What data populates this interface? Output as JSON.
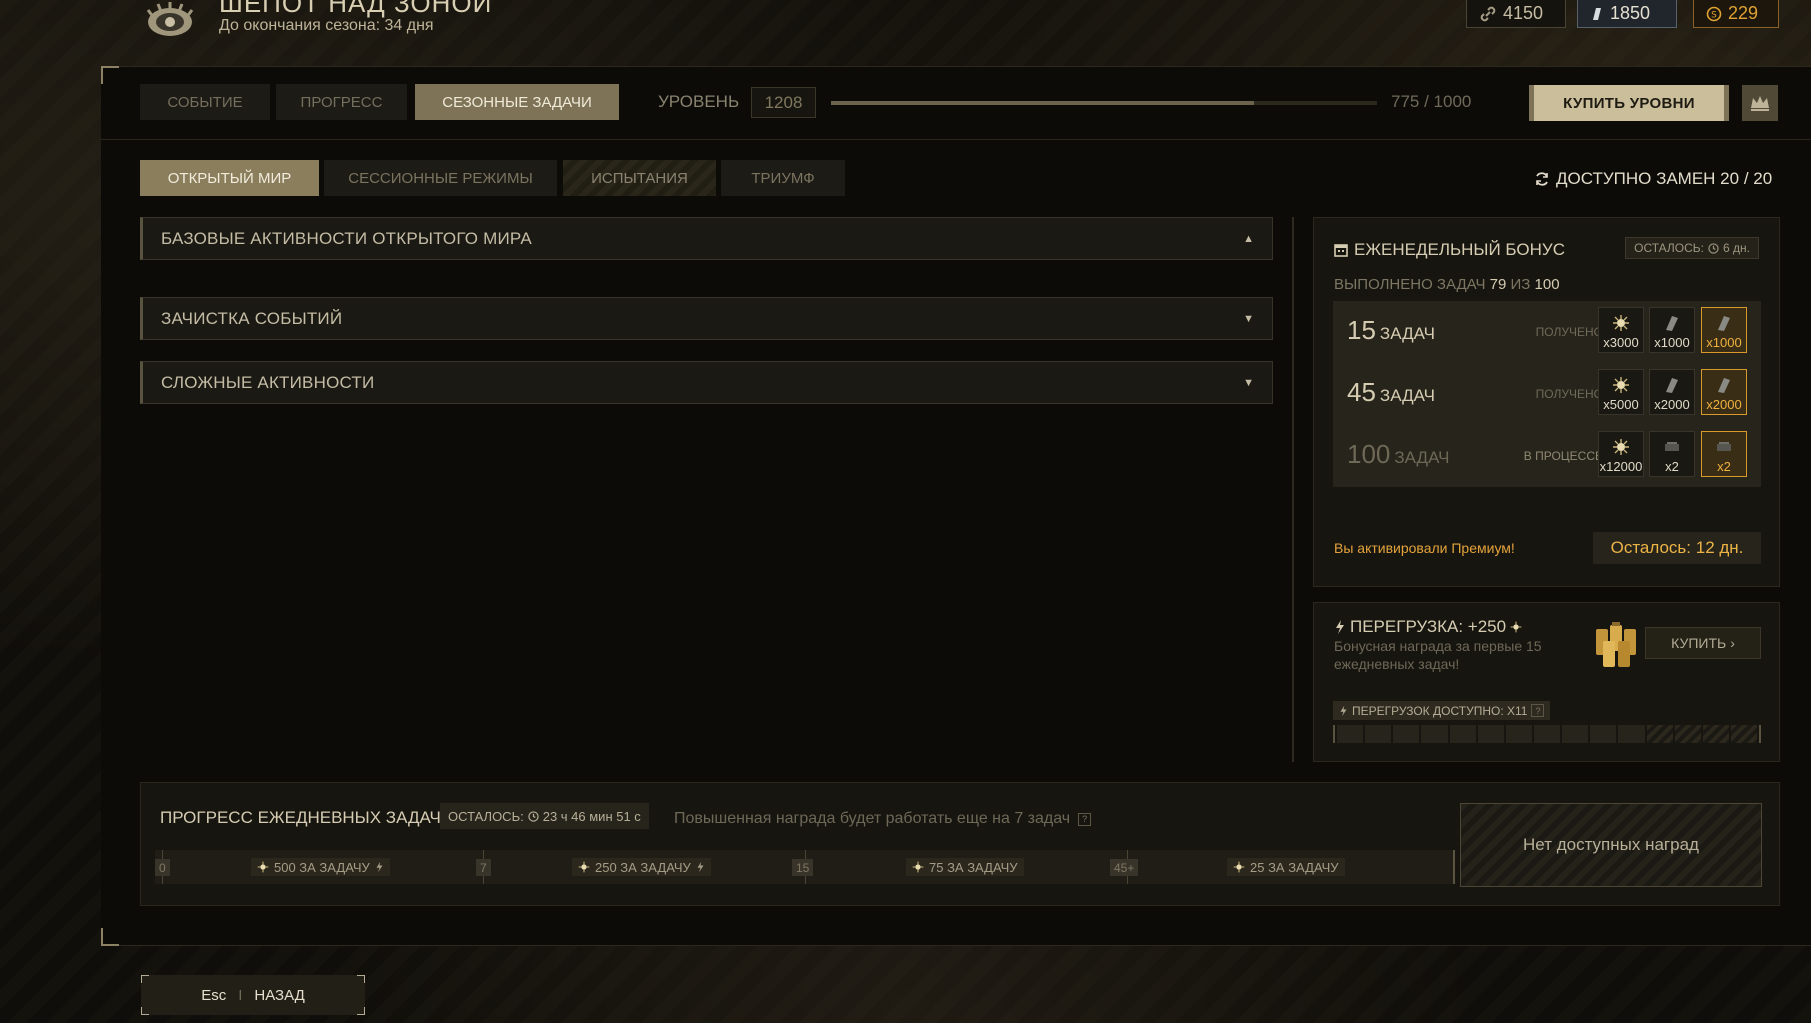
{
  "header": {
    "title": "ШЕПОТ НАД ЗОНОЙ",
    "season_left": "До окончания сезона: 34 дня"
  },
  "currencies": [
    {
      "icon": "link-icon",
      "value": "4150"
    },
    {
      "icon": "crystal-icon",
      "value": "1850"
    },
    {
      "icon": "coin-icon",
      "value": "229",
      "color": "#e0a332"
    }
  ],
  "top_tabs": [
    {
      "label": "СОБЫТИЕ",
      "active": false
    },
    {
      "label": "ПРОГРЕСС",
      "active": false
    },
    {
      "label": "СЕЗОННЫЕ ЗАДАЧИ",
      "active": true
    }
  ],
  "level": {
    "label": "УРОВЕНЬ",
    "value": "1208",
    "progress_text": "775 / 1000",
    "progress_fraction": 0.775
  },
  "buy_levels_label": "КУПИТЬ УРОВНИ",
  "sub_tabs": [
    {
      "label": "ОТКРЫТЫЙ МИР",
      "active": true
    },
    {
      "label": "СЕССИОННЫЕ РЕЖИМЫ",
      "active": false
    },
    {
      "label": "ИСПЫТАНИЯ",
      "active": false
    },
    {
      "label": "ТРИУМФ",
      "active": false
    }
  ],
  "swaps_label": "ДОСТУПНО ЗАМЕН 20 / 20",
  "accordions": [
    {
      "label": "БАЗОВЫЕ АКТИВНОСТИ ОТКРЫТОГО МИРА",
      "arrow": "▲"
    },
    {
      "label": "ЗАЧИСТКА СОБЫТИЙ",
      "arrow": "▼"
    },
    {
      "label": "СЛОЖНЫЕ АКТИВНОСТИ",
      "arrow": "▼"
    }
  ],
  "weekly": {
    "title": "ЕЖЕНЕДЕЛЬНЫЙ БОНУС",
    "left_label": "ОСТАЛОСЬ:",
    "left_value": "6 дн.",
    "done_prefix": "ВЫПОЛНЕНО ЗАДАЧ",
    "done_count": "79",
    "done_of": "ИЗ",
    "done_total": "100",
    "tiers": [
      {
        "num": "15",
        "unit": "ЗАДАЧ",
        "status": "ПОЛУЧЕНО",
        "rewards": [
          "x3000",
          "x1000",
          "x1000"
        ]
      },
      {
        "num": "45",
        "unit": "ЗАДАЧ",
        "status": "ПОЛУЧЕНО",
        "rewards": [
          "x5000",
          "x2000",
          "x2000"
        ]
      },
      {
        "num": "100",
        "unit": "ЗАДАЧ",
        "status": "В ПРОЦЕССЕ",
        "rewards": [
          "x12000",
          "x2",
          "x2"
        ]
      }
    ],
    "premium_text": "Вы активировали Премиум!",
    "premium_left": "Осталось: 12 дн."
  },
  "overload": {
    "title": "ПЕРЕГРУЗКА: +250",
    "desc": "Бонусная награда за первые 15 ежедневных задач!",
    "buy_label": "КУПИТЬ",
    "available": "ПЕРЕГРУЗОК ДОСТУПНО: x11",
    "help": "?",
    "segments_filled": 11,
    "segments_total": 15
  },
  "daily": {
    "title": "ПРОГРЕСС ЕЖЕДНЕВНЫХ ЗАДАЧ",
    "left_label": "ОСТАЛОСЬ:",
    "left_value": "23 ч 46 мин 51 с",
    "note": "Повышенная награда будет работать еще на 7 задач",
    "help": "?",
    "marks": [
      "0",
      "7",
      "15",
      "45+"
    ],
    "rewards": [
      "500 ЗА ЗАДАЧУ",
      "250 ЗА ЗАДАЧУ",
      "75 ЗА ЗАДАЧУ",
      "25 ЗА ЗАДАЧУ"
    ],
    "no_rewards": "Нет доступных наград"
  },
  "back": {
    "key": "Esc",
    "sep": "I",
    "label": "НАЗАД"
  },
  "colors": {
    "accent": "#cbbf9b",
    "gold": "#e0a332",
    "tab_active": "#7e7356"
  }
}
